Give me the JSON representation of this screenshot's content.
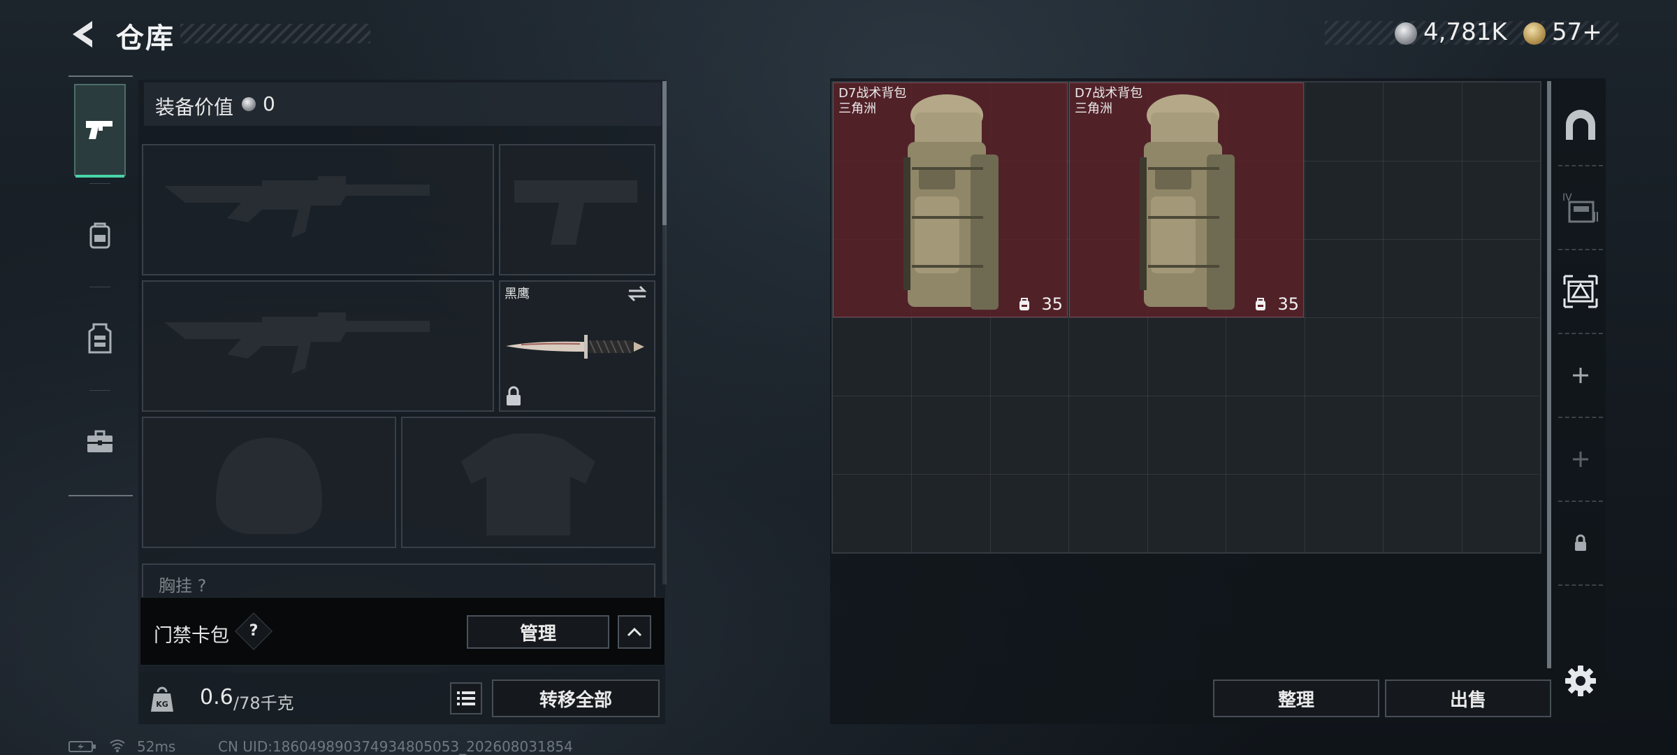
{
  "header": {
    "title": "仓库",
    "currencies": [
      {
        "icon": "silver-coin-icon",
        "value": "4,781K"
      },
      {
        "icon": "gold-coin-icon",
        "value": "57+"
      }
    ]
  },
  "left_tabs": [
    {
      "name": "weapons",
      "icon": "pistol-icon",
      "active": true
    },
    {
      "name": "backpack",
      "icon": "backpack-icon",
      "active": false
    },
    {
      "name": "armor",
      "icon": "vest-icon",
      "active": false
    },
    {
      "name": "case",
      "icon": "briefcase-icon",
      "active": false
    }
  ],
  "loadout": {
    "value_label": "装备价值",
    "value_amount": "0",
    "slots": [
      {
        "slot": "primary-1",
        "icon": "rifle-icon",
        "filled": false
      },
      {
        "slot": "pistol",
        "icon": "pistol-icon",
        "filled": false
      },
      {
        "slot": "primary-2",
        "icon": "rifle-icon",
        "filled": false
      },
      {
        "slot": "melee",
        "name": "黑鹰",
        "icon": "knife-icon",
        "filled": true,
        "locked": true
      },
      {
        "slot": "helmet",
        "icon": "helmet-icon",
        "filled": false
      },
      {
        "slot": "body-armor",
        "icon": "armor-icon",
        "filled": false
      }
    ],
    "chest_rig_label": "胸挂 ?"
  },
  "keycard": {
    "label": "门禁卡包",
    "help": "?",
    "manage_label": "管理"
  },
  "weight": {
    "current": "0.6",
    "max": "/78千克",
    "icon_label": "KG",
    "transfer_all_label": "转移全部"
  },
  "stash": {
    "columns": 9,
    "rows": 6,
    "items": [
      {
        "name": "D7战术背包",
        "subtitle": "三角洲",
        "capacity": "35",
        "color": "#602028"
      },
      {
        "name": "D7战术背包",
        "subtitle": "三角洲",
        "capacity": "35",
        "color": "#602028"
      }
    ],
    "organize_label": "整理",
    "sell_label": "出售"
  },
  "right_tabs": [
    {
      "name": "stash-1",
      "icon": "arch-icon"
    },
    {
      "name": "stash-4",
      "icon": "stash-iv-icon"
    },
    {
      "name": "stash-delta",
      "icon": "delta-crate-icon",
      "active": true
    },
    {
      "name": "add-1",
      "icon": "plus-icon"
    },
    {
      "name": "add-2",
      "icon": "plus-icon"
    },
    {
      "name": "locked",
      "icon": "lock-icon"
    }
  ],
  "status": {
    "ping": "52ms",
    "uid": "CN UID:186049890374934805053_202608031854"
  },
  "colors": {
    "accent": "#49d4a7",
    "item_background": "#602028"
  }
}
